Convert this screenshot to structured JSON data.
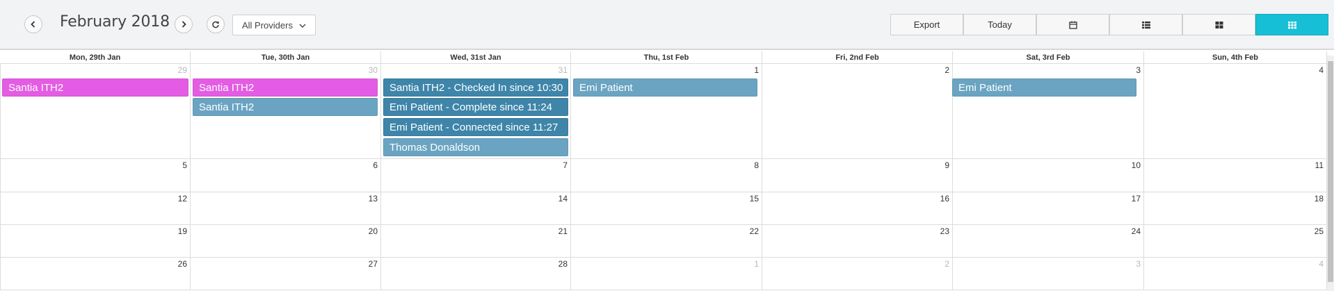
{
  "header": {
    "month_title": "February 2018",
    "provider_filter": "All Providers",
    "buttons": {
      "export": "Export",
      "today": "Today"
    }
  },
  "calendar": {
    "weekday_headers": [
      "Mon, 29th Jan",
      "Tue, 30th Jan",
      "Wed, 31st Jan",
      "Thu, 1st Feb",
      "Fri, 2nd Feb",
      "Sat, 3rd Feb",
      "Sun, 4th Feb"
    ],
    "weeks": [
      [
        "29",
        "30",
        "31",
        "1",
        "2",
        "3",
        "4"
      ],
      [
        "5",
        "6",
        "7",
        "8",
        "9",
        "10",
        "11"
      ],
      [
        "12",
        "13",
        "14",
        "15",
        "16",
        "17",
        "18"
      ],
      [
        "19",
        "20",
        "21",
        "22",
        "23",
        "24",
        "25"
      ],
      [
        "26",
        "27",
        "28",
        "1",
        "2",
        "3",
        "4"
      ]
    ],
    "events": {
      "mon_1": "Santia ITH2",
      "tue_1": "Santia ITH2",
      "tue_2": "Santia ITH2",
      "wed_1": "Santia ITH2 - Checked In since 10:30",
      "wed_2": "Emi Patient - Complete since 11:24",
      "wed_3": "Emi Patient - Connected since 11:27",
      "wed_4": "Thomas Donaldson",
      "thu_1": "Emi Patient",
      "sat_1": "Emi Patient"
    }
  },
  "colors": {
    "active_view": "#17bfd6",
    "event_magenta": "#e45ce3",
    "event_blue": "#6aa4c2",
    "event_dark": "#3e85a9"
  },
  "icons": [
    "chevron-left-icon",
    "chevron-right-icon",
    "refresh-icon",
    "chevron-down-icon",
    "calendar-icon",
    "list-icon",
    "grid-icon",
    "month-grid-icon"
  ]
}
